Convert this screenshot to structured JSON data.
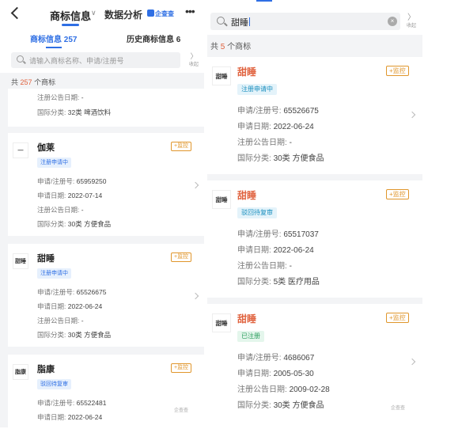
{
  "left": {
    "header": {
      "main_tab": "商标信息",
      "analysis_tab": "数据分析",
      "brand": "企查查",
      "more": "•••"
    },
    "subtabs": {
      "active": "商标信息 257",
      "inactive": "历史商标信息 6"
    },
    "search": {
      "placeholder": "请输入商标名称、申请/注册号",
      "collapse": "收起"
    },
    "count": {
      "prefix": "共",
      "value": "257",
      "suffix": "个商标"
    },
    "labels": {
      "reg_no": "申请/注册号:",
      "apply_date": "申请日期:",
      "announce_date": "注册公告日期:",
      "intl_class": "国际分类:"
    },
    "partial_card": {
      "announce_date": "-",
      "intl_class": "32类 啤酒饮料"
    },
    "cards": [
      {
        "logo": "—",
        "name": "伽莱",
        "monitor": "+监控",
        "status": "注册申请中",
        "reg_no": "65959250",
        "apply_date": "2022-07-14",
        "announce_date": "-",
        "intl_class": "30类 方便食品"
      },
      {
        "logo": "甜睡",
        "name": "甜睡",
        "monitor": "+监控",
        "status": "注册申请中",
        "reg_no": "65526675",
        "apply_date": "2022-06-24",
        "announce_date": "-",
        "intl_class": "30类 方便食品"
      },
      {
        "logo": "脂康",
        "name": "脂康",
        "monitor": "+监控",
        "status": "驳回待复审",
        "reg_no": "65522481",
        "apply_date": "2022-06-24"
      }
    ],
    "watermark": "企查查"
  },
  "right": {
    "search": {
      "query": "甜睡",
      "clear": "×",
      "collapse": "收起"
    },
    "count": {
      "prefix": "共",
      "value": "5",
      "suffix": "个商标"
    },
    "labels": {
      "reg_no": "申请/注册号:",
      "apply_date": "申请日期:",
      "announce_date": "注册公告日期:",
      "intl_class": "国际分类:"
    },
    "cards": [
      {
        "logo": "甜睡",
        "name": "甜睡",
        "monitor": "+监控",
        "status": "注册申请中",
        "reg_no": "65526675",
        "apply_date": "2022-06-24",
        "announce_date": "-",
        "intl_class": "30类 方便食品"
      },
      {
        "logo": "甜睡",
        "name": "甜睡",
        "monitor": "+监控",
        "status": "驳回待复审",
        "reg_no": "65517037",
        "apply_date": "2022-06-24",
        "announce_date": "-",
        "intl_class": "5类 医疗用品"
      },
      {
        "logo": "甜睡",
        "name": "甜睡",
        "monitor": "+监控",
        "status": "已注册",
        "reg_no": "4686067",
        "apply_date": "2005-05-30",
        "announce_date": "2009-02-28",
        "intl_class": "30类 方便食品"
      }
    ],
    "watermark": "企查查"
  },
  "colors": {
    "accent": "#2f6fe4",
    "highlight": "#e0623e",
    "monitor": "#e0962c"
  }
}
